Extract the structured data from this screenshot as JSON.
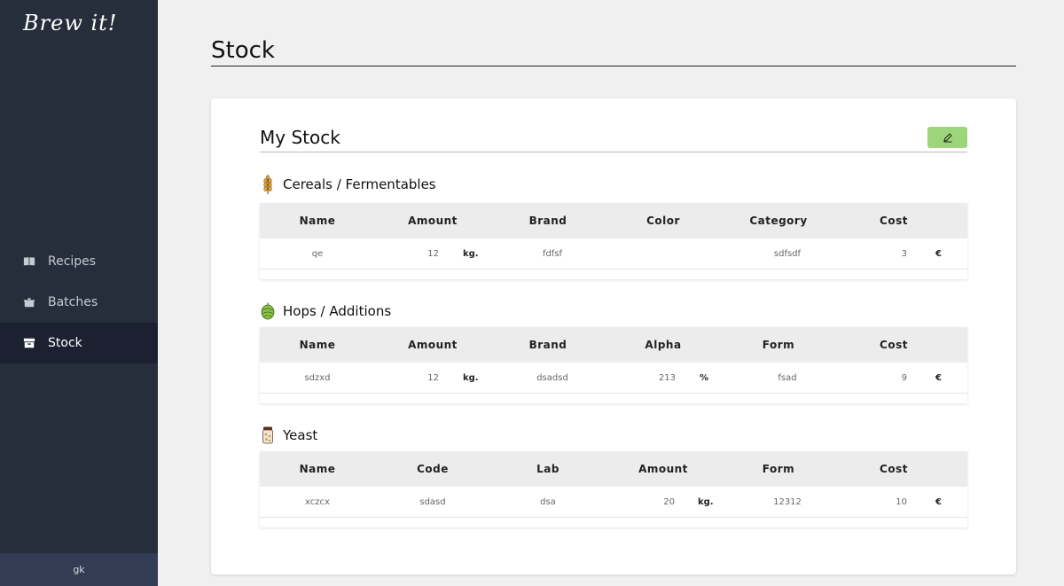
{
  "app": {
    "logo": "Brew it!"
  },
  "sidebar": {
    "items": [
      {
        "label": "Recipes",
        "icon": "book-icon"
      },
      {
        "label": "Batches",
        "icon": "pot-icon"
      },
      {
        "label": "Stock",
        "icon": "archive-icon",
        "active": true
      }
    ],
    "user": "gk"
  },
  "page": {
    "title": "Stock"
  },
  "stock": {
    "title": "My Stock",
    "edit_icon": "pencil-icon",
    "accent": "#9dd57a",
    "cereals": {
      "title": "Cereals / Fermentables",
      "icon": "wheat-icon",
      "headers": [
        "Name",
        "Amount",
        "Brand",
        "Color",
        "Category",
        "Cost"
      ],
      "row": {
        "name": "qe",
        "amount": "12",
        "amount_unit": "kg.",
        "brand": "fdfsf",
        "color": "",
        "category": "sdfsdf",
        "cost": "3",
        "cost_unit": "€"
      }
    },
    "hops": {
      "title": "Hops / Additions",
      "icon": "hop-icon",
      "headers": [
        "Name",
        "Amount",
        "Brand",
        "Alpha",
        "Form",
        "Cost"
      ],
      "row": {
        "name": "sdzxd",
        "amount": "12",
        "amount_unit": "kg.",
        "brand": "dsadsd",
        "alpha": "213",
        "alpha_unit": "%",
        "form": "fsad",
        "cost": "9",
        "cost_unit": "€"
      }
    },
    "yeast": {
      "title": "Yeast",
      "icon": "yeast-jar-icon",
      "headers": [
        "Name",
        "Code",
        "Lab",
        "Amount",
        "Form",
        "Cost"
      ],
      "row": {
        "name": "xczcx",
        "code": "sdasd",
        "lab": "dsa",
        "amount": "20",
        "amount_unit": "kg.",
        "form": "12312",
        "cost": "10",
        "cost_unit": "€"
      }
    }
  }
}
